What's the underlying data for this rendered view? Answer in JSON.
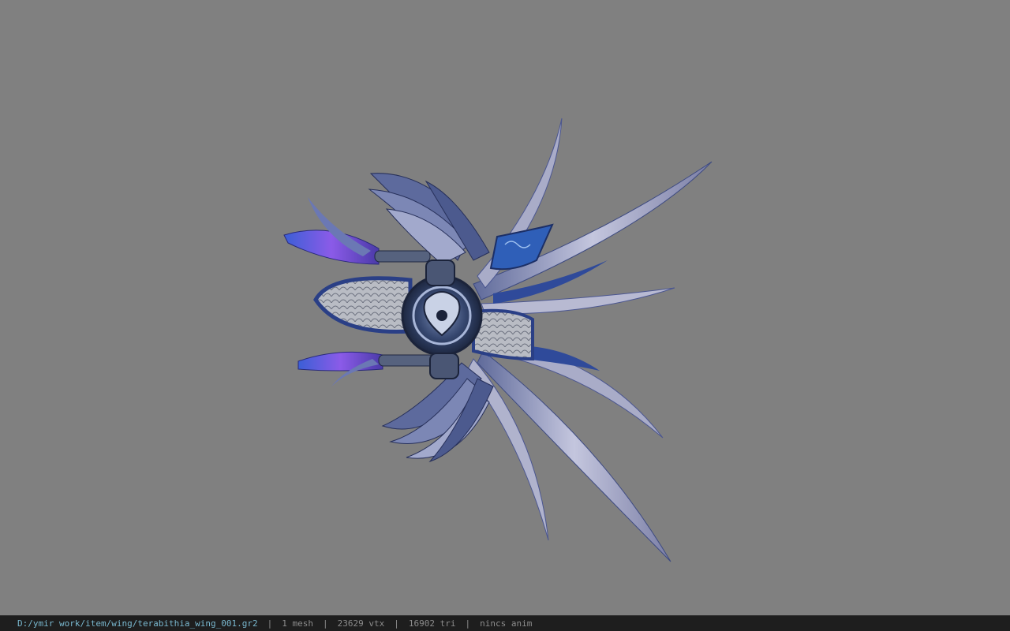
{
  "viewport": {
    "background_color": "#808080",
    "model": "wing mesh (blue/silver wings with purple tassels)"
  },
  "status_bar": {
    "file_path": "D:/ymir work/item/wing/terabithia_wing_001.gr2",
    "mesh_count": "1 mesh",
    "vertex_count": "23629 vtx",
    "triangle_count": "16902 tri",
    "animation": "nincs anim",
    "separator": "|",
    "path_color": "#79b8cf"
  }
}
